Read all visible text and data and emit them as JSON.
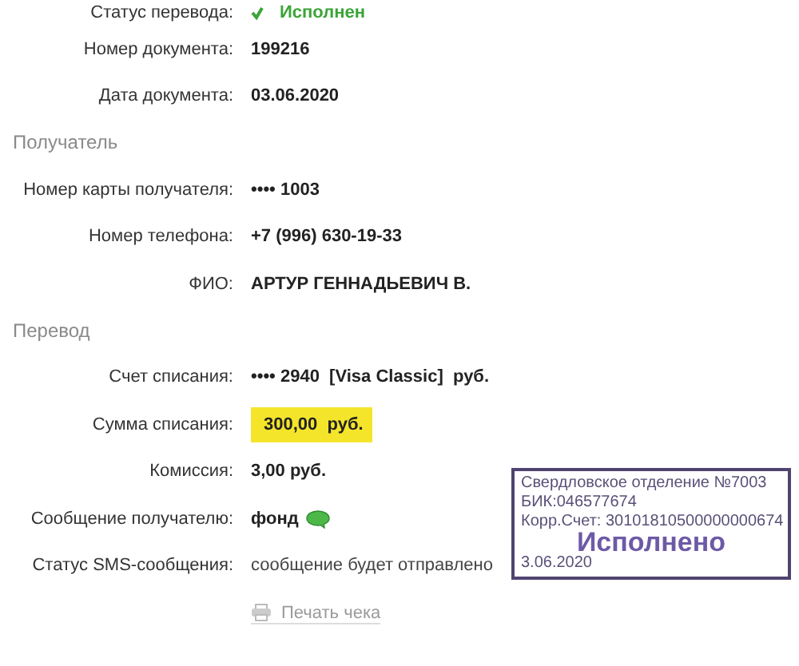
{
  "status_row": {
    "label": "Статус перевода:",
    "value": "Исполнен"
  },
  "header_rows": [
    {
      "label": "Номер документа:",
      "value": "199216"
    },
    {
      "label": "Дата документа:",
      "value": "03.06.2020"
    }
  ],
  "sections": [
    {
      "title": "Получатель",
      "rows": [
        {
          "label": "Номер карты получателя:",
          "value": "•••• 1003",
          "kind": "plain"
        },
        {
          "label": "Номер телефона:",
          "value": "+7 (996) 630-19-33",
          "kind": "plain"
        },
        {
          "label": "ФИО:",
          "value": "АРТУР ГЕННАДЬЕВИЧ В.",
          "kind": "plain"
        }
      ]
    },
    {
      "title": "Перевод",
      "rows": [
        {
          "label": "Счет списания:",
          "value": "•••• 2940  [Visa Classic]  руб.",
          "kind": "plain"
        },
        {
          "label": "Сумма списания:",
          "value": "300,00  руб.",
          "kind": "highlight"
        },
        {
          "label": "Комиссия:",
          "value": "3,00 руб.",
          "kind": "plain"
        },
        {
          "label": "Сообщение получателю:",
          "value": "фонд",
          "kind": "sms"
        },
        {
          "label": "Статус SMS-сообщения:",
          "value": "сообщение будет отправлено",
          "kind": "light"
        }
      ]
    }
  ],
  "print_link": "Печать чека",
  "stamp": {
    "lines": [
      "Свердловское отделение №7003",
      "БИК:046577674",
      "Корр.Счет: 30101810500000000674"
    ],
    "status": "Исполнено",
    "date": "3.06.2020"
  }
}
